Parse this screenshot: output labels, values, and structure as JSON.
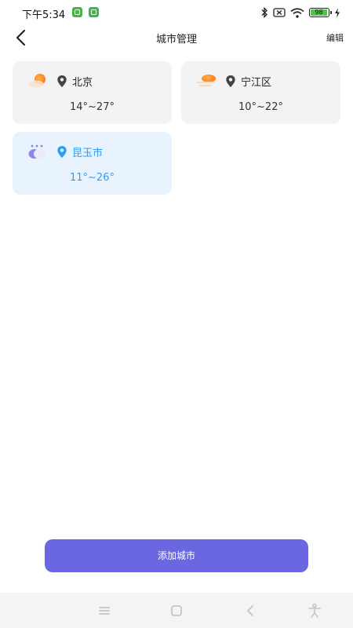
{
  "status_bar": {
    "time": "下午5:34",
    "battery": "98",
    "icons": [
      "app-icon",
      "app-icon",
      "bluetooth-icon",
      "no-sim-icon",
      "wifi-icon",
      "battery-icon",
      "charging-icon"
    ]
  },
  "header": {
    "title": "城市管理",
    "edit_label": "编辑",
    "back_icon": "back-arrow-icon"
  },
  "cities": [
    {
      "name": "北京",
      "temp": "14°~27°",
      "weather_icon": "sunny-cloudy-icon",
      "active": false
    },
    {
      "name": "宁江区",
      "temp": "10°~22°",
      "weather_icon": "windy-sun-icon",
      "active": false
    },
    {
      "name": "昆玉市",
      "temp": "11°~26°",
      "weather_icon": "cloudy-icon",
      "active": true
    }
  ],
  "add_button": {
    "label": "添加城市"
  },
  "nav_bar": {
    "icons": [
      "menu-icon",
      "home-icon",
      "back-icon",
      "accessibility-icon"
    ]
  },
  "colors": {
    "accent": "#6a67e0",
    "active_text": "#2f9df2",
    "active_card": "#e9f3fe",
    "card": "#f3f3f5"
  }
}
